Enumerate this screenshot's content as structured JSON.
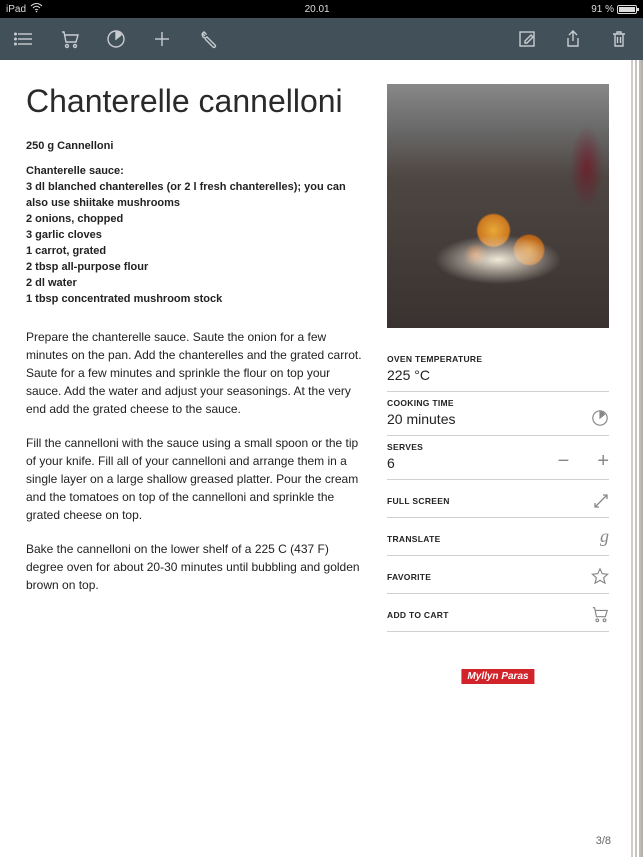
{
  "status": {
    "carrier": "iPad",
    "time": "20.01",
    "battery_pct": "91 %"
  },
  "recipe": {
    "title": "Chanterelle cannelloni",
    "main_ingredient": "250 g Cannelloni",
    "sauce_heading": "Chanterelle sauce:",
    "sauce_ingredients": [
      "3 dl blanched chanterelles (or 2 l fresh chanterelles); you can also use shiitake mushrooms",
      "2 onions, chopped",
      "3 garlic cloves",
      "1 carrot, grated",
      "2 tbsp all-purpose flour",
      "2 dl water",
      "1 tbsp concentrated mushroom stock"
    ],
    "instructions": [
      "Prepare the chanterelle sauce. Saute the onion for a few minutes on the pan. Add the chanterelles and the grated carrot. Saute for a few minutes and sprinkle the flour on top your sauce. Add the water and adjust your seasonings. At the very end add the grated cheese to the sauce.",
      "Fill the cannelloni with the sauce using a small spoon or the tip of your knife. Fill all of your cannelloni and arrange them in a single layer on a large shallow greased platter. Pour the cream and the tomatoes on top of the cannelloni and sprinkle the grated cheese on top.",
      "Bake the cannelloni on the lower shelf of a 225 C (437 F) degree oven for about 20-30 minutes until bubbling and golden brown on top."
    ]
  },
  "meta": {
    "oven_label": "OVEN TEMPERATURE",
    "oven_value": "225 °C",
    "cook_label": "COOKING TIME",
    "cook_value": "20 minutes",
    "serves_label": "SERVES",
    "serves_value": "6",
    "fullscreen_label": "FULL SCREEN",
    "translate_label": "TRANSLATE",
    "favorite_label": "FAVORITE",
    "addcart_label": "ADD TO CART"
  },
  "brand": "Myllyn Paras",
  "page_indicator": "3/8"
}
